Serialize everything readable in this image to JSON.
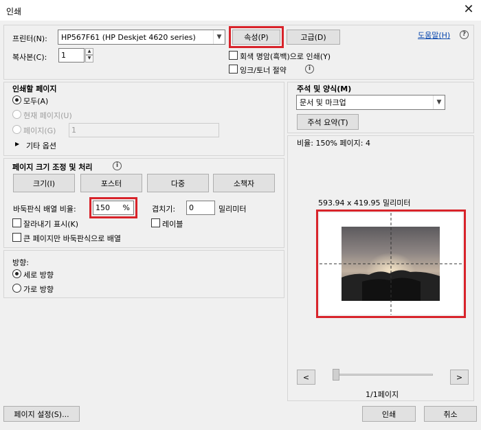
{
  "window": {
    "title": "인쇄",
    "close_glyph": "✕"
  },
  "printer": {
    "label": "프린터(N):",
    "selected": "HP567F61 (HP Deskjet 4620 series)",
    "properties_button": "속성(P)",
    "advanced_button": "고급(D)",
    "help_link": "도움말(H)",
    "copies_label": "복사본(C):",
    "copies_value": "1",
    "grayscale_label": "회색 명암(흑백)으로 인쇄(Y)",
    "save_ink_label": "잉크/토너 절약"
  },
  "pages": {
    "heading": "인쇄할 페이지",
    "all_label": "모두(A)",
    "current_label": "현재 페이지(U)",
    "pages_label": "페이지(G)",
    "pages_value": "1",
    "more_options": "기타 옵션"
  },
  "sizing": {
    "heading": "페이지 크기 조정 및 처리",
    "size_button": "크기(I)",
    "poster_button": "포스터",
    "multiple_button": "다중",
    "booklet_button": "소책자",
    "tile_scale_label": "바둑판식 배열 비율:",
    "tile_scale_value": "150",
    "percent_symbol": "%",
    "overlap_label": "겹치기:",
    "overlap_value": "0",
    "overlap_unit": "밀리미터",
    "cut_marks_label": "잘라내기 표시(K)",
    "labels_label": "레이블",
    "large_pages_only_label": "큰 페이지만 바둑판식으로 배열"
  },
  "orientation": {
    "heading": "방향:",
    "portrait_label": "세로 방향",
    "landscape_label": "가로 방향"
  },
  "comments": {
    "heading": "주석 및 양식(M)",
    "selected": "문서 및 마크업",
    "summarize_button": "주석 요약(T)"
  },
  "preview": {
    "scale_info": "비율: 150% 페이지: 4",
    "dimensions": "593.94 x 419.95 밀리미터",
    "prev_glyph": "<",
    "next_glyph": ">",
    "page_counter": "1/1페이지",
    "slider_fraction": 0
  },
  "footer": {
    "page_setup_button": "페이지 설정(S)...",
    "print_button": "인쇄",
    "cancel_button": "취소"
  },
  "colors": {
    "highlight_red": "#d8232a",
    "window_bg": "#f0f0f0",
    "link_blue": "#0645ad"
  }
}
